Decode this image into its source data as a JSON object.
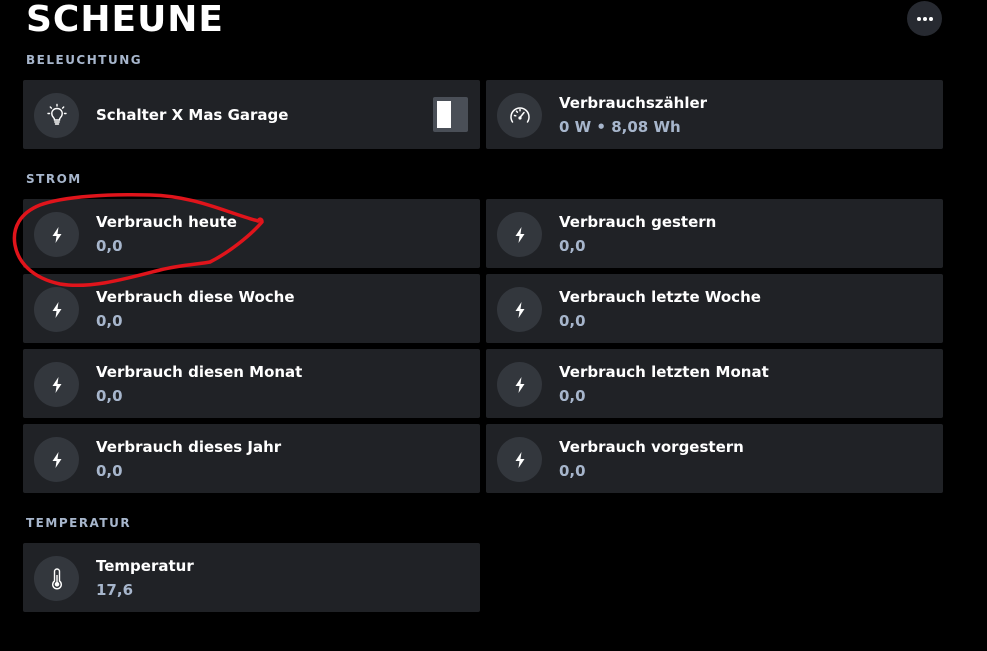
{
  "page": {
    "title": "SCHEUNE"
  },
  "header": {
    "more_icon": "more-horizontal-icon"
  },
  "sections": {
    "beleuchtung": {
      "label": "BELEUCHTUNG",
      "cards": [
        {
          "name": "Schalter X Mas Garage",
          "icon": "lightbulb-icon",
          "toggle_on": false
        },
        {
          "name": "Verbrauchszähler",
          "value": "0 W • 8,08 Wh",
          "icon": "gauge-icon"
        }
      ]
    },
    "strom": {
      "label": "STROM",
      "cards": [
        {
          "name": "Verbrauch heute",
          "value": "0,0",
          "icon": "lightning-icon"
        },
        {
          "name": "Verbrauch gestern",
          "value": "0,0",
          "icon": "lightning-icon"
        },
        {
          "name": "Verbrauch diese Woche",
          "value": "0,0",
          "icon": "lightning-icon"
        },
        {
          "name": "Verbrauch letzte Woche",
          "value": "0,0",
          "icon": "lightning-icon"
        },
        {
          "name": "Verbrauch diesen Monat",
          "value": "0,0",
          "icon": "lightning-icon"
        },
        {
          "name": "Verbrauch letzten Monat",
          "value": "0,0",
          "icon": "lightning-icon"
        },
        {
          "name": "Verbrauch dieses Jahr",
          "value": "0,0",
          "icon": "lightning-icon"
        },
        {
          "name": "Verbrauch vorgestern",
          "value": "0,0",
          "icon": "lightning-icon"
        }
      ]
    },
    "temperatur": {
      "label": "TEMPERATUR",
      "cards": [
        {
          "name": "Temperatur",
          "value": "17,6",
          "icon": "thermometer-icon"
        }
      ]
    }
  },
  "colors": {
    "background": "#000000",
    "card": "#202226",
    "icon_circle": "#33373d",
    "section_label": "#a7b6cc",
    "value_text": "#a7b6cc",
    "annotation": "#e0141b"
  },
  "annotation": {
    "shape": "hand-drawn circle",
    "target": "Verbrauch heute"
  }
}
